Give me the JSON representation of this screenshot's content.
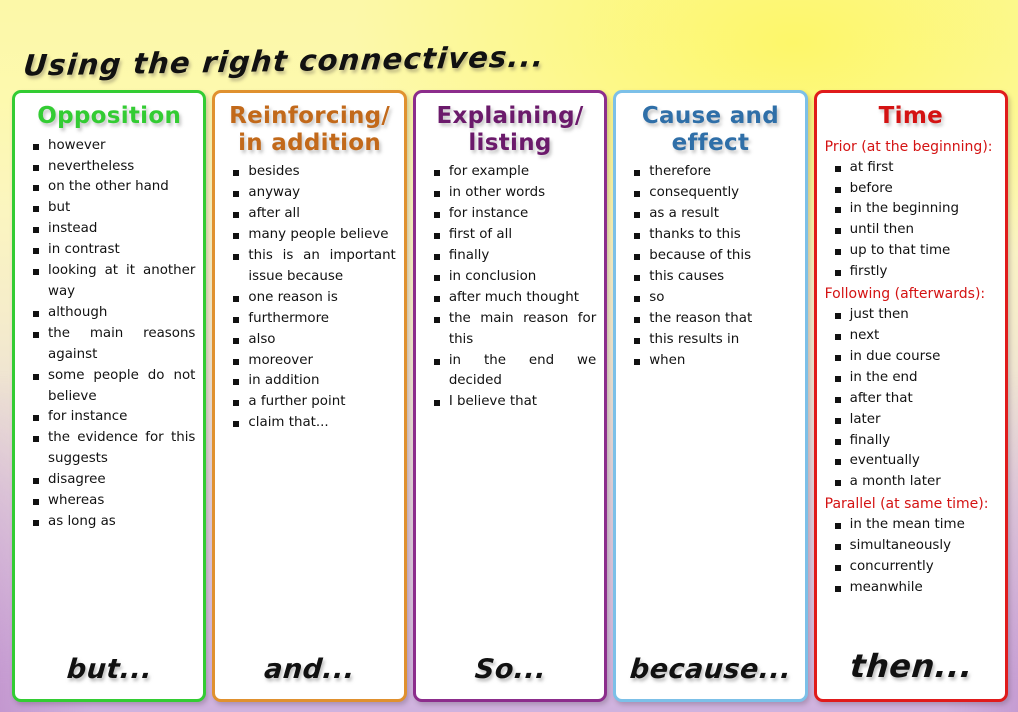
{
  "title": "Using the right connectives...",
  "columns": [
    {
      "heading": "Opposition",
      "accent": "#33cc33",
      "footer": "but...",
      "items": [
        "however",
        "nevertheless",
        "on the other hand",
        "but",
        "instead",
        "in contrast",
        "looking at it another way",
        "although",
        "the main reasons against",
        "some people do not believe",
        "for instance",
        "the evidence for this suggests",
        "disagree",
        "whereas",
        "as long as"
      ]
    },
    {
      "heading": "Reinforcing/ in addition",
      "heading_line1": "Reinforcing/",
      "heading_line2": "in addition",
      "accent": "#e0912f",
      "title_color": "#c2691a",
      "footer": "and...",
      "items": [
        "besides",
        "anyway",
        "after all",
        "many people believe",
        "this is an important issue because",
        "one reason is",
        "furthermore",
        "also",
        "moreover",
        "in addition",
        "a further point",
        "claim that..."
      ]
    },
    {
      "heading": "Explaining/ listing",
      "heading_line1": "Explaining/",
      "heading_line2": "listing",
      "accent": "#8c2d8c",
      "title_color": "#6b1a6b",
      "footer": "So...",
      "items": [
        "for example",
        "in other words",
        "for instance",
        "first of all",
        "finally",
        "in conclusion",
        "after much thought",
        "the main reason for this",
        "in the end we decided",
        "I believe that"
      ]
    },
    {
      "heading": "Cause and effect",
      "heading_line1": "Cause and",
      "heading_line2": "effect",
      "accent": "#7cc0e8",
      "title_color": "#2f6fa8",
      "footer": "because...",
      "items": [
        "therefore",
        "consequently",
        "as a result",
        "thanks to this",
        "because of this",
        "this causes",
        "so",
        "the reason that",
        "this results in",
        "when"
      ]
    },
    {
      "heading": "Time",
      "accent": "#e01b1b",
      "title_color": "#d41313",
      "footer": "then...",
      "groups": [
        {
          "subhead": "Prior (at the beginning):",
          "items": [
            "at first",
            "before",
            "in the beginning",
            "until then",
            "up to that time",
            "firstly"
          ]
        },
        {
          "subhead": "Following (afterwards):",
          "items": [
            "just then",
            "next",
            "in due course",
            "in the end",
            "after that",
            "later",
            "finally",
            "eventually",
            "a month later"
          ]
        },
        {
          "subhead": "Parallel (at same time):",
          "items": [
            "in the mean time",
            "simultaneously",
            "concurrently",
            "meanwhile"
          ]
        }
      ]
    }
  ]
}
